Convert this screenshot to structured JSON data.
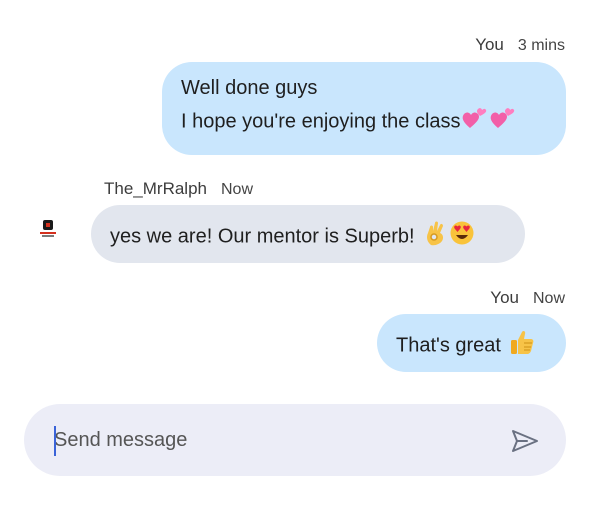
{
  "messages": [
    {
      "author": "You",
      "time": "3 mins",
      "lines": [
        "Well done guys",
        "I hope you're enjoying the class"
      ],
      "emoji": [
        "two-hearts",
        "two-hearts"
      ],
      "direction": "outgoing"
    },
    {
      "author": "The_MrRalph",
      "time": "Now",
      "text": "yes we are! Our mentor is Superb!",
      "emoji": [
        "ok-hand",
        "heart-eyes"
      ],
      "direction": "incoming",
      "avatar": "mrralph-logo"
    },
    {
      "author": "You",
      "time": "Now",
      "text": "That's great",
      "emoji": [
        "thumbs-up"
      ],
      "direction": "outgoing"
    }
  ],
  "composer": {
    "placeholder": "Send message",
    "value": ""
  },
  "colors": {
    "outgoing_bubble": "#c9e6fd",
    "incoming_bubble": "#e2e6ee",
    "composer_bg": "#ecedf7",
    "caret": "#3a63d8"
  },
  "icons": {
    "send": "send-icon"
  }
}
